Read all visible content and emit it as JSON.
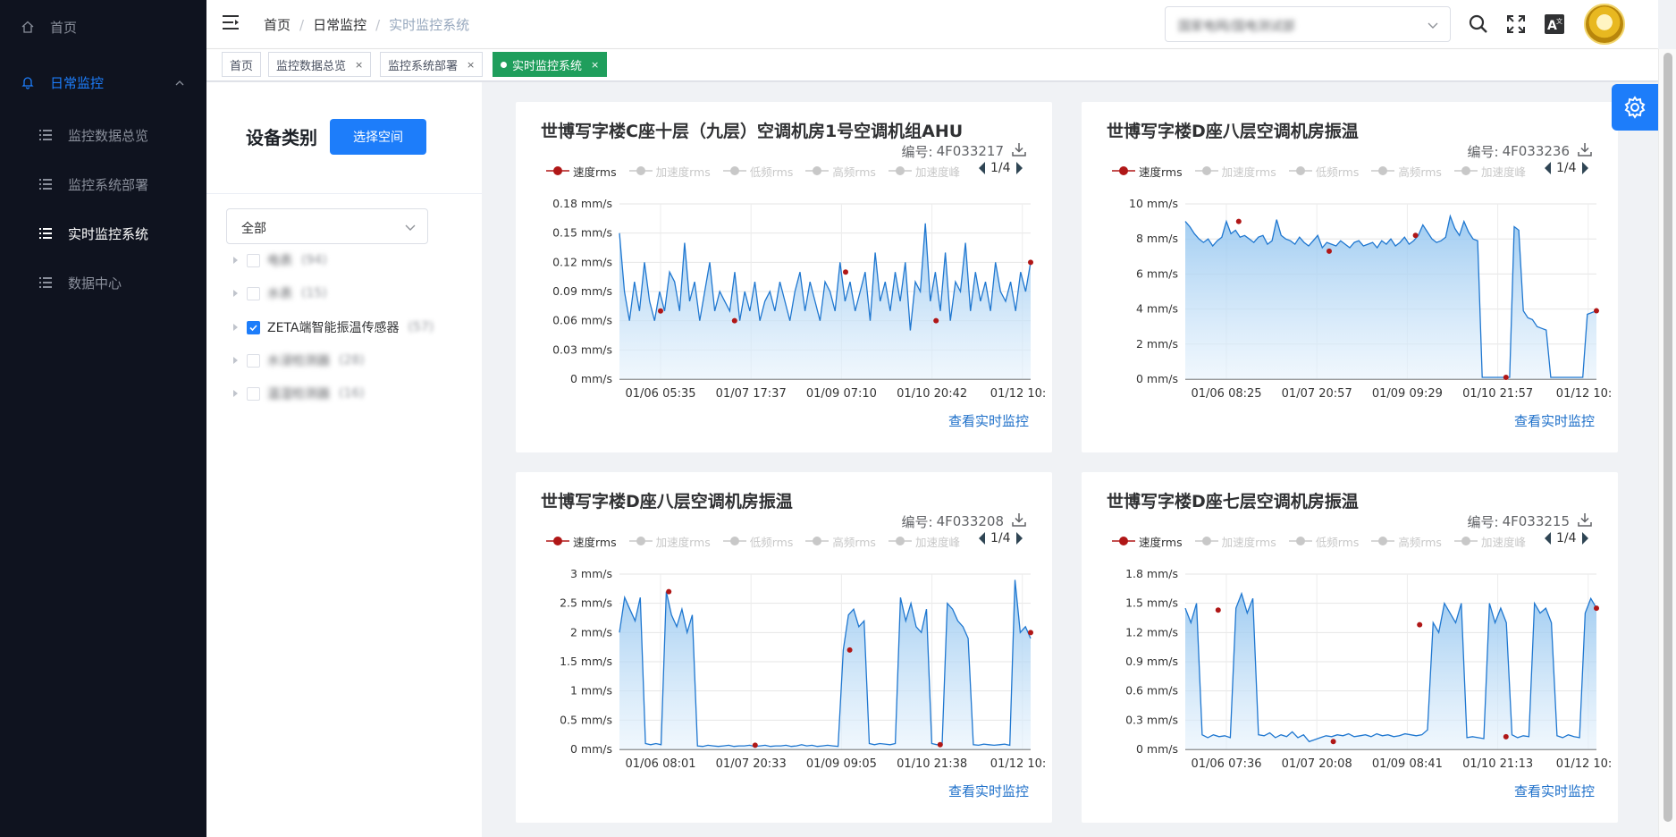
{
  "sidebar": {
    "items": [
      {
        "label": "首页",
        "icon": "home-icon"
      },
      {
        "label": "日常监控",
        "icon": "bell-icon"
      },
      {
        "label": "监控数据总览",
        "icon": "list-icon"
      },
      {
        "label": "监控系统部署",
        "icon": "list-icon"
      },
      {
        "label": "实时监控系统",
        "icon": "list-icon"
      },
      {
        "label": "数据中心",
        "icon": "list-icon"
      }
    ]
  },
  "header": {
    "breadcrumb": [
      "首页",
      "日常监控",
      "实时监控系统"
    ],
    "org_select_value": "国家电网/国电测试部"
  },
  "tags": [
    {
      "label": "首页",
      "active": false
    },
    {
      "label": "监控数据总览",
      "active": false
    },
    {
      "label": "监控系统部署",
      "active": false
    },
    {
      "label": "实时监控系统",
      "active": true
    }
  ],
  "panel": {
    "title": "设备类别",
    "choose_button": "选择空间",
    "category_select": "全部",
    "tree": [
      {
        "label": "电表",
        "count": "(94)",
        "checked": false,
        "blurred": true
      },
      {
        "label": "水表",
        "count": "(15)",
        "checked": false,
        "blurred": true
      },
      {
        "label": "ZETA端智能振温传感器",
        "count": "(57)",
        "checked": true,
        "blurred": false
      },
      {
        "label": "水浸检测器",
        "count": "(28)",
        "checked": false,
        "blurred": true
      },
      {
        "label": "温湿检测器",
        "count": "(16)",
        "checked": false,
        "blurred": true
      }
    ]
  },
  "legend": {
    "items": [
      "速度rms",
      "加速度rms",
      "低频rms",
      "高频rms",
      "加速度峰"
    ],
    "page": "1/4"
  },
  "code_label": "编号:",
  "view_link": "查看实时监控",
  "colors": {
    "accent": "#1d7dfa",
    "series": "#1f77d0",
    "marker": "#b01717",
    "active_tag": "#1f9e5c"
  },
  "chart_data": [
    {
      "type": "area",
      "title": "世博写字楼C座十层（九层）空调机房1号空调机组AHU",
      "code": "4F033217",
      "unit": "mm/s",
      "yticks": [
        "0.18 mm/s",
        "0.15 mm/s",
        "0.12 mm/s",
        "0.09 mm/s",
        "0.06 mm/s",
        "0.03 mm/s",
        "0 mm/s"
      ],
      "ylim": [
        0,
        0.18
      ],
      "xticks": [
        "01/06 05:35",
        "01/07 17:37",
        "01/09 07:10",
        "01/10 20:42",
        "01/12 10:"
      ],
      "series": [
        {
          "name": "速度rms",
          "values": [
            0.15,
            0.09,
            0.06,
            0.1,
            0.07,
            0.12,
            0.08,
            0.06,
            0.09,
            0.07,
            0.11,
            0.1,
            0.07,
            0.14,
            0.08,
            0.1,
            0.06,
            0.09,
            0.12,
            0.07,
            0.09,
            0.08,
            0.07,
            0.11,
            0.06,
            0.09,
            0.07,
            0.1,
            0.06,
            0.08,
            0.09,
            0.07,
            0.1,
            0.08,
            0.06,
            0.09,
            0.11,
            0.07,
            0.1,
            0.08,
            0.06,
            0.1,
            0.09,
            0.07,
            0.12,
            0.08,
            0.1,
            0.07,
            0.09,
            0.11,
            0.06,
            0.13,
            0.08,
            0.1,
            0.07,
            0.11,
            0.08,
            0.12,
            0.05,
            0.1,
            0.09,
            0.16,
            0.08,
            0.11,
            0.07,
            0.13,
            0.06,
            0.1,
            0.09,
            0.14,
            0.07,
            0.11,
            0.08,
            0.1,
            0.07,
            0.12,
            0.09,
            0.08,
            0.1,
            0.07,
            0.11,
            0.09,
            0.12
          ]
        }
      ],
      "markers": [
        [
          0.1,
          0.07
        ],
        [
          0.28,
          0.06
        ],
        [
          0.55,
          0.11
        ],
        [
          0.77,
          0.06
        ],
        [
          1.0,
          0.12
        ]
      ]
    },
    {
      "type": "area",
      "title": "世博写字楼D座八层空调机房振温",
      "code": "4F033236",
      "unit": "mm/s",
      "yticks": [
        "10 mm/s",
        "8 mm/s",
        "6 mm/s",
        "4 mm/s",
        "2 mm/s",
        "0 mm/s"
      ],
      "ylim": [
        0,
        10
      ],
      "xticks": [
        "01/06 08:25",
        "01/07 20:57",
        "01/09 09:29",
        "01/10 21:57",
        "01/12 10:"
      ],
      "series": [
        {
          "name": "速度rms",
          "values": [
            9,
            8.7,
            8.3,
            8,
            7.8,
            8,
            7.6,
            7.9,
            8.1,
            9,
            8.3,
            8.5,
            8.1,
            8.2,
            8,
            7.8,
            8.1,
            8.2,
            7.7,
            7.9,
            9.1,
            8.2,
            8,
            7.9,
            7.7,
            8.1,
            7.8,
            7.6,
            7.9,
            8.2,
            7.5,
            7.8,
            7.7,
            7.6,
            7.9,
            7.7,
            7.5,
            7.8,
            7.9,
            7.6,
            7.7,
            7.8,
            7.5,
            7.9,
            7.7,
            8,
            7.6,
            7.8,
            8.1,
            7.7,
            7.9,
            8.2,
            8.8,
            8.4,
            8,
            7.8,
            7.9,
            8.1,
            9.3,
            8.6,
            8.2,
            9,
            8.4,
            8,
            7.9,
            0.1,
            0.1,
            0.1,
            0.1,
            0.1,
            0.1,
            0.1,
            8.7,
            8.5,
            3.9,
            3.5,
            3.4,
            3,
            2.9,
            2.8,
            0.1,
            0.1,
            0.1,
            0.1,
            0.1,
            0.1,
            0.1,
            0.1,
            3.7,
            3.8,
            3.9
          ]
        }
      ],
      "markers": [
        [
          0.13,
          9
        ],
        [
          0.35,
          7.3
        ],
        [
          0.56,
          8.2
        ],
        [
          0.78,
          0.1
        ],
        [
          1.0,
          3.9
        ]
      ]
    },
    {
      "type": "area",
      "title": "世博写字楼D座八层空调机房振温",
      "code": "4F033208",
      "unit": "mm/s",
      "yticks": [
        "3 mm/s",
        "2.5 mm/s",
        "2 mm/s",
        "1.5 mm/s",
        "1 mm/s",
        "0.5 mm/s",
        "0 mm/s"
      ],
      "ylim": [
        0,
        3
      ],
      "xticks": [
        "01/06 08:01",
        "01/07 20:33",
        "01/09 09:05",
        "01/10 21:38",
        "01/12 10:"
      ],
      "series": [
        {
          "name": "速度rms",
          "values": [
            2,
            2.6,
            2.4,
            2.2,
            2.6,
            0.1,
            0.08,
            0.1,
            0.08,
            2.7,
            2.3,
            2.1,
            2.4,
            2,
            2.3,
            0.06,
            0.05,
            0.07,
            0.06,
            0.05,
            0.06,
            0.07,
            0.05,
            0.06,
            0.06,
            0.07,
            0.05,
            0.06,
            0.07,
            0.05,
            0.06,
            0.06,
            0.07,
            0.05,
            0.06,
            0.08,
            0.06,
            0.07,
            0.05,
            0.06,
            0.07,
            0.06,
            0.05,
            1.7,
            2.3,
            2.4,
            2.1,
            2.2,
            0.1,
            0.08,
            0.1,
            0.09,
            0.08,
            0.1,
            2.6,
            2.2,
            2.5,
            2.1,
            2,
            2.4,
            0.1,
            0.08,
            0.09,
            2.5,
            2.4,
            2.2,
            2.1,
            1.9,
            0.08,
            0.07,
            0.09,
            0.08,
            0.07,
            0.08,
            0.09,
            0.07,
            2.9,
            2,
            2.1,
            1.9
          ]
        }
      ],
      "markers": [
        [
          0.12,
          2.7
        ],
        [
          0.33,
          0.07
        ],
        [
          0.56,
          1.7
        ],
        [
          0.78,
          0.08
        ],
        [
          1.0,
          2
        ]
      ]
    },
    {
      "type": "area",
      "title": "世博写字楼D座七层空调机房振温",
      "code": "4F033215",
      "unit": "mm/s",
      "yticks": [
        "1.8 mm/s",
        "1.5 mm/s",
        "1.2 mm/s",
        "0.9 mm/s",
        "0.6 mm/s",
        "0.3 mm/s",
        "0 mm/s"
      ],
      "ylim": [
        0,
        1.8
      ],
      "xticks": [
        "01/06 07:36",
        "01/07 20:08",
        "01/09 08:41",
        "01/10 21:13",
        "01/12 10:"
      ],
      "series": [
        {
          "name": "速度rms",
          "values": [
            1.45,
            1.3,
            1.5,
            0.15,
            0.12,
            0.15,
            0.13,
            0.14,
            0.12,
            1.45,
            1.6,
            1.4,
            1.55,
            0.15,
            0.14,
            0.17,
            0.12,
            0.15,
            0.13,
            0.18,
            0.12,
            0.15,
            0.08,
            0.1,
            0.12,
            0.14,
            0.13,
            0.15,
            0.14,
            0.16,
            0.13,
            0.14,
            0.15,
            0.13,
            0.16,
            0.14,
            0.15,
            0.13,
            0.14,
            0.16,
            0.15,
            0.14,
            0.15,
            0.2,
            1.3,
            1.2,
            1.5,
            1.4,
            1.3,
            1.5,
            0.12,
            0.13,
            0.12,
            0.11,
            1.5,
            1.3,
            1.45,
            1.3,
            0.15,
            0.12,
            0.14,
            0.13,
            1.5,
            1.4,
            1.45,
            1.3,
            0.14,
            0.12,
            0.15,
            0.13,
            0.12,
            1.4,
            1.55,
            1.45
          ]
        }
      ],
      "markers": [
        [
          0.08,
          1.43
        ],
        [
          0.36,
          0.08
        ],
        [
          0.57,
          1.28
        ],
        [
          0.78,
          0.13
        ],
        [
          1.0,
          1.45
        ]
      ]
    }
  ]
}
